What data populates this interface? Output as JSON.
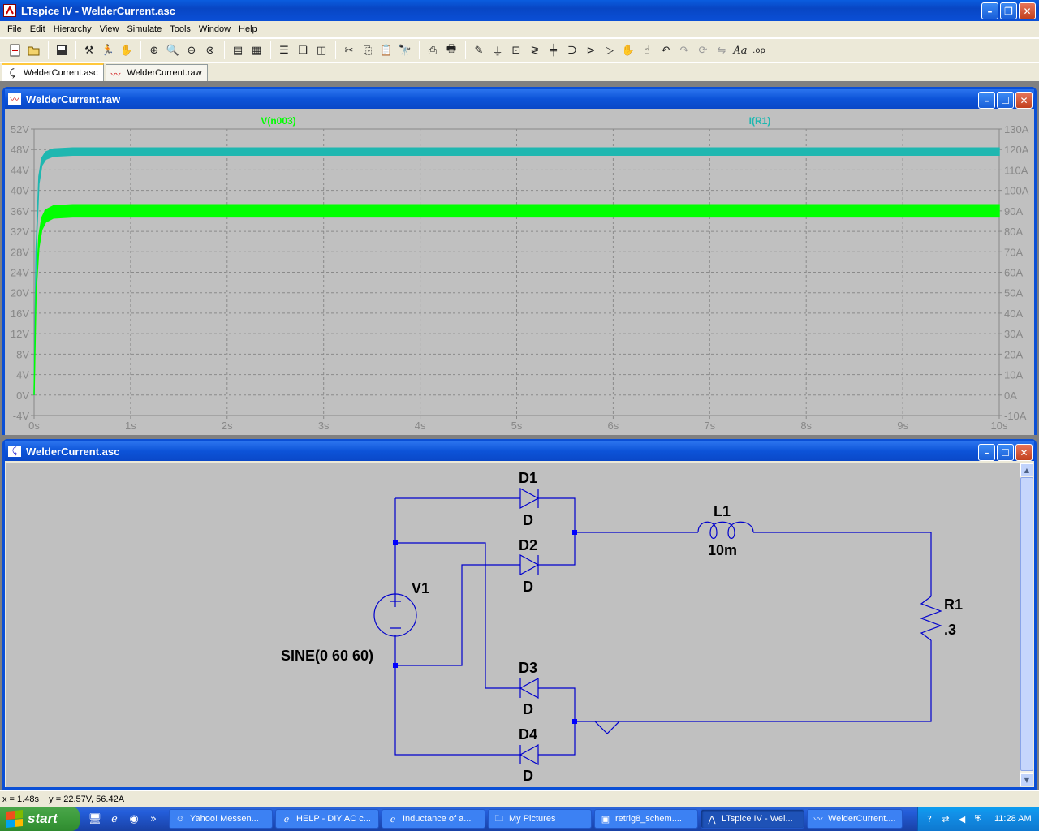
{
  "window": {
    "title": "LTspice IV - WelderCurrent.asc"
  },
  "menu": [
    "File",
    "Edit",
    "Hierarchy",
    "View",
    "Simulate",
    "Tools",
    "Window",
    "Help"
  ],
  "toolbar_icons": [
    "new-schematic-icon",
    "open-icon",
    "save-icon",
    "control-panel-icon",
    "run-icon",
    "pan-icon",
    "zoom-in-icon",
    "zoom-full-icon",
    "zoom-out-icon",
    "zoom-cancel-icon",
    "autorange-icon",
    "grid-icon",
    "tile-horizontal-icon",
    "cascade-icon",
    "tile-vertical-icon",
    "cut-icon",
    "copy-icon",
    "paste-icon",
    "find-icon",
    "print-preview-icon",
    "print-icon",
    "wire-icon",
    "ground-icon",
    "label-icon",
    "resistor-icon",
    "capacitor-icon",
    "inductor-icon",
    "diode-icon",
    "component-icon",
    "move-icon",
    "drag-icon",
    "undo-icon",
    "redo-icon",
    "rotate-icon",
    "mirror-icon",
    "text-icon",
    "spice-directive-icon"
  ],
  "tabs": [
    {
      "label": "WelderCurrent.asc",
      "active": true
    },
    {
      "label": "WelderCurrent.raw",
      "active": false
    }
  ],
  "wave_window": {
    "title": "WelderCurrent.raw"
  },
  "sch_window": {
    "title": "WelderCurrent.asc"
  },
  "chart_data": {
    "type": "line",
    "title": "",
    "series": [
      {
        "name": "V(n003)",
        "axis": "left",
        "color": "#00ff00",
        "x": [
          0,
          0.02,
          0.05,
          0.08,
          0.12,
          0.2,
          0.4,
          1,
          10
        ],
        "y": [
          0,
          20,
          30,
          33.5,
          35,
          35.8,
          36,
          36,
          36
        ],
        "band": 1.2
      },
      {
        "name": "I(R1)",
        "axis": "right",
        "color": "#1fb7b0",
        "x": [
          0,
          0.02,
          0.05,
          0.08,
          0.12,
          0.2,
          0.4,
          1,
          10
        ],
        "y": [
          0,
          70,
          105,
          114,
          117,
          118.5,
          119,
          119,
          119
        ],
        "band": 1.8
      }
    ],
    "x_range": [
      0,
      10
    ],
    "x_ticks": [
      "0s",
      "1s",
      "2s",
      "3s",
      "4s",
      "5s",
      "6s",
      "7s",
      "8s",
      "9s",
      "10s"
    ],
    "y_left_range": [
      -4,
      52
    ],
    "y_left_ticks": [
      "52V",
      "48V",
      "44V",
      "40V",
      "36V",
      "32V",
      "28V",
      "24V",
      "20V",
      "16V",
      "12V",
      "8V",
      "4V",
      "0V",
      "-4V"
    ],
    "y_right_range": [
      -10,
      130
    ],
    "y_right_ticks": [
      "130A",
      "120A",
      "110A",
      "100A",
      "90A",
      "80A",
      "70A",
      "60A",
      "50A",
      "40A",
      "30A",
      "20A",
      "10A",
      "0A",
      "-10A"
    ],
    "grid": true
  },
  "schematic": {
    "components": {
      "D1": {
        "name": "D1",
        "value": "D"
      },
      "D2": {
        "name": "D2",
        "value": "D"
      },
      "D3": {
        "name": "D3",
        "value": "D"
      },
      "D4": {
        "name": "D4",
        "value": "D"
      },
      "L1": {
        "name": "L1",
        "value": "10m"
      },
      "R1": {
        "name": "R1",
        "value": ".3"
      },
      "V1": {
        "name": "V1",
        "value": "SINE(0 60 60)"
      }
    }
  },
  "status": {
    "text": "x = 1.48s    y = 22.57V, 56.42A"
  },
  "taskbar": {
    "start": "start",
    "tasks": [
      {
        "label": "Yahoo! Messen...",
        "icon": "yahoo-icon",
        "active": false
      },
      {
        "label": "HELP - DIY AC c...",
        "icon": "ie-icon",
        "active": false
      },
      {
        "label": "Inductance of a...",
        "icon": "ie-icon",
        "active": false
      },
      {
        "label": "My Pictures",
        "icon": "folder-icon",
        "active": false
      },
      {
        "label": "retrig8_schem....",
        "icon": "image-icon",
        "active": false
      },
      {
        "label": "LTspice IV - Wel...",
        "icon": "ltspice-icon",
        "active": true
      },
      {
        "label": "WelderCurrent....",
        "icon": "waveform-icon",
        "active": false
      }
    ],
    "clock": "11:28 AM"
  }
}
